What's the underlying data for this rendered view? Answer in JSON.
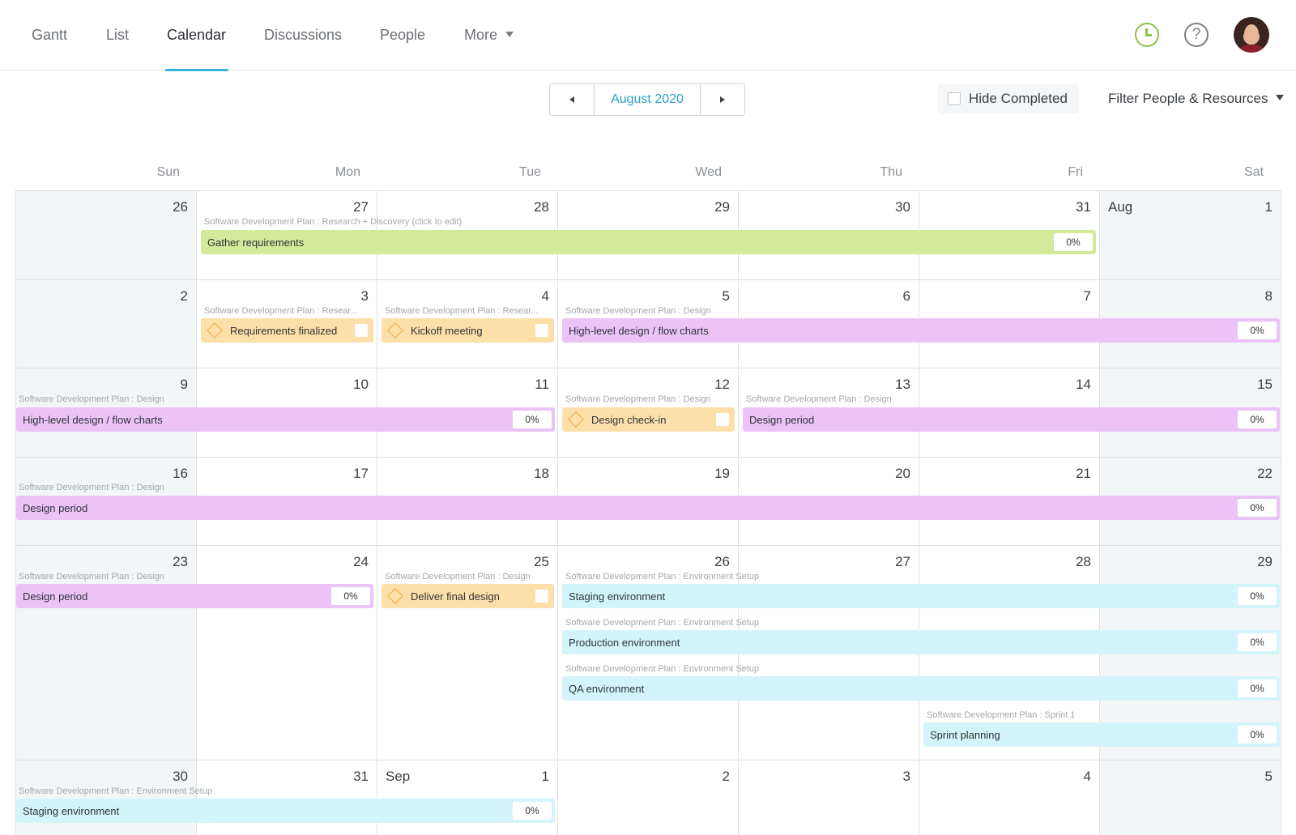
{
  "nav": {
    "tabs": [
      {
        "label": "Gantt"
      },
      {
        "label": "List"
      },
      {
        "label": "Calendar",
        "active": true
      },
      {
        "label": "Discussions"
      },
      {
        "label": "People"
      },
      {
        "label": "More"
      }
    ],
    "help_glyph": "?",
    "icons": [
      "clock-icon",
      "help-icon",
      "avatar"
    ]
  },
  "toolbar": {
    "month_label": "August 2020",
    "hide_completed_label": "Hide Completed",
    "hide_completed_checked": false,
    "filter_label": "Filter People & Resources"
  },
  "calendar": {
    "weekdays": [
      "Sun",
      "Mon",
      "Tue",
      "Wed",
      "Thu",
      "Fri",
      "Sat"
    ],
    "weeks": [
      [
        "26",
        "27",
        "28",
        "29",
        "30",
        "31",
        "1"
      ],
      [
        "2",
        "3",
        "4",
        "5",
        "6",
        "7",
        "8"
      ],
      [
        "9",
        "10",
        "11",
        "12",
        "13",
        "14",
        "15"
      ],
      [
        "16",
        "17",
        "18",
        "19",
        "20",
        "21",
        "22"
      ],
      [
        "23",
        "24",
        "25",
        "26",
        "27",
        "28",
        "29"
      ],
      [
        "30",
        "31",
        "1",
        "2",
        "3",
        "4",
        "5"
      ]
    ],
    "month_labels": {
      "aug": "Aug",
      "sep": "Sep"
    },
    "events": [
      {
        "ctx": "Software Development Plan : Research + Discovery (click to edit)",
        "name": "Gather requirements",
        "pct": "0%",
        "color": "#d4e99b"
      },
      {
        "ctx": "Software Development Plan : Resear...",
        "name": "Requirements finalized",
        "milestone": true
      },
      {
        "ctx": "Software Development Plan : Resear...",
        "name": "Kickoff meeting",
        "milestone": true
      },
      {
        "ctx": "Software Development Plan : Design",
        "name": "High-level design / flow charts",
        "pct": "0%",
        "color": "#ebc3f7"
      },
      {
        "ctx": "Software Development Plan : Design",
        "name": "High-level design / flow charts",
        "pct": "0%"
      },
      {
        "ctx": "Software Development Plan : Design",
        "name": "Design check-in",
        "milestone": true
      },
      {
        "ctx": "Software Development Plan : Design",
        "name": "Design period",
        "pct": "0%"
      },
      {
        "ctx": "Software Development Plan : Design",
        "name": "Design period",
        "pct": "0%"
      },
      {
        "ctx": "Software Development Plan : Design",
        "name": "Design period",
        "pct": "0%"
      },
      {
        "ctx": "Software Development Plan : Design",
        "name": "Deliver final design",
        "milestone": true
      },
      {
        "ctx": "Software Development Plan : Environment Setup",
        "name": "Staging environment",
        "pct": "0%",
        "color": "#d3f4fb"
      },
      {
        "ctx": "Software Development Plan : Environment Setup",
        "name": "Production environment",
        "pct": "0%"
      },
      {
        "ctx": "Software Development Plan : Environment Setup",
        "name": "QA environment",
        "pct": "0%"
      },
      {
        "ctx": "Software Development Plan : Sprint 1",
        "name": "Sprint planning",
        "pct": "0%"
      },
      {
        "ctx": "Software Development Plan : Environment Setup",
        "name": "Staging environment",
        "pct": "0%"
      }
    ],
    "milestone_color": "#fddfaa"
  }
}
